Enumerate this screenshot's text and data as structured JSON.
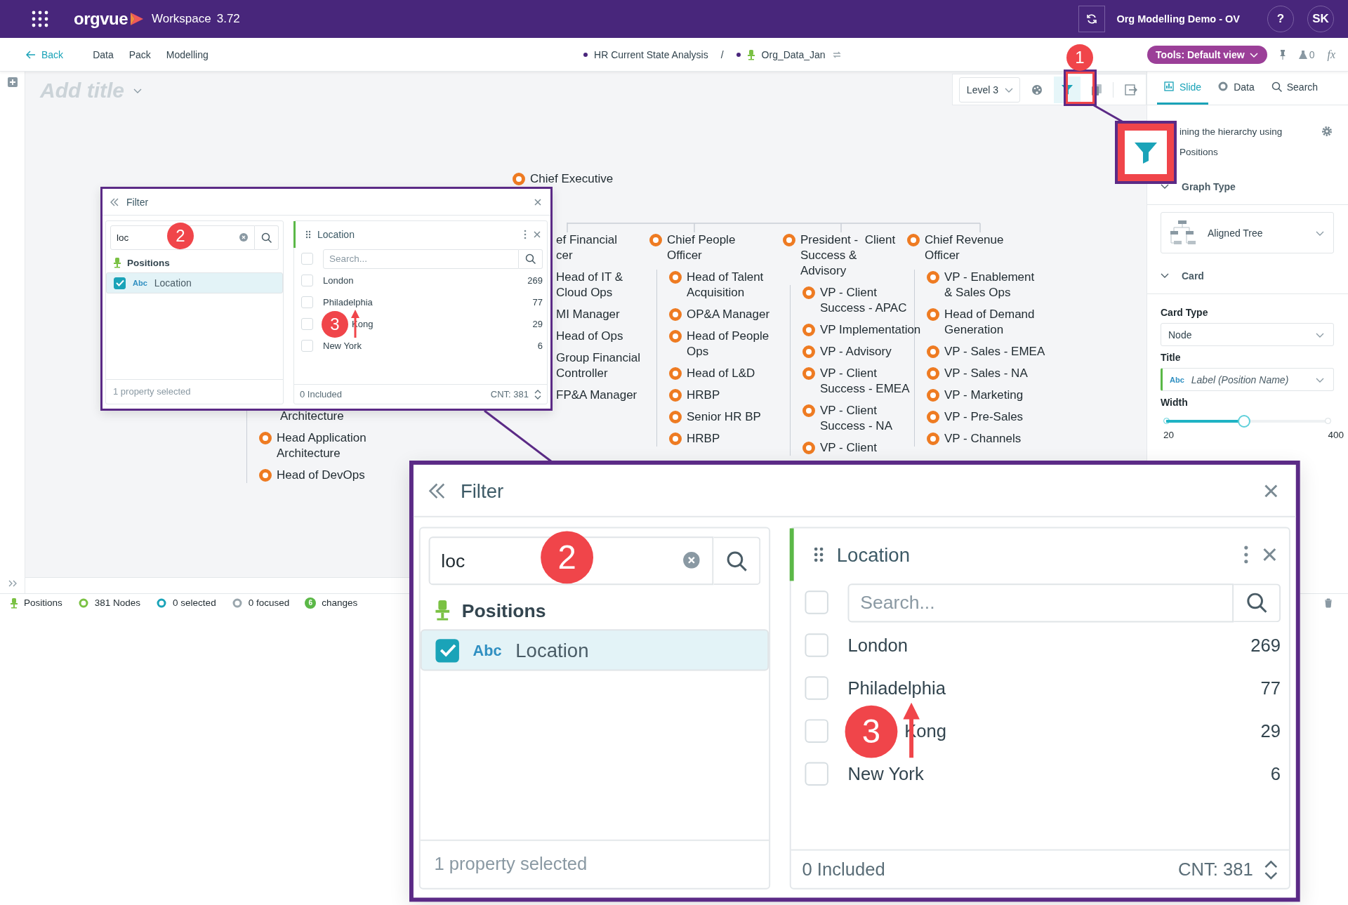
{
  "top_bar": {
    "logo": "orgvue",
    "product": "Workspace",
    "version": "3.72",
    "project": "Org Modelling Demo - OV",
    "help": "?",
    "user": "SK"
  },
  "nav": {
    "back": "Back",
    "links": [
      "Data",
      "Pack",
      "Modelling"
    ],
    "breadcrumb": [
      {
        "kind": "pack",
        "label": "HR Current State Analysis"
      },
      {
        "kind": "dataset",
        "label": "Org_Data_Jan"
      }
    ],
    "separator": "/",
    "tools": "Tools: Default view",
    "flask_count": "0",
    "formula": "fx"
  },
  "canvas": {
    "title_placeholder": "Add title",
    "level": "Level 3",
    "filter_active": true
  },
  "org_chart": {
    "root": {
      "label": "Chief Executive",
      "marker": true
    },
    "columns": [
      {
        "kind": "clipped",
        "label": "ef Financial\ncer",
        "marker": false,
        "children": [
          {
            "label": "Head of IT &\nCloud Ops",
            "marker": false
          },
          {
            "label": "MI Manager",
            "marker": false
          },
          {
            "label": "Head of Ops",
            "marker": false
          },
          {
            "label": "Group Financial\nController",
            "marker": false
          },
          {
            "label": "FP&A Manager",
            "marker": false
          }
        ]
      },
      {
        "kind": "full",
        "label": "Chief People\nOfficer",
        "marker": true,
        "children": [
          {
            "label": "Head of Talent\nAcquisition",
            "marker": true
          },
          {
            "label": "OP&A Manager",
            "marker": true
          },
          {
            "label": "Head of People\nOps",
            "marker": true
          },
          {
            "label": "Head of L&D",
            "marker": true
          },
          {
            "label": "HRBP",
            "marker": true
          },
          {
            "label": "Senior HR BP",
            "marker": true
          },
          {
            "label": "HRBP",
            "marker": true
          }
        ]
      },
      {
        "kind": "full",
        "label": "President -  Client\nSuccess &\nAdvisory",
        "marker": true,
        "children": [
          {
            "label": "VP - Client\nSuccess - APAC",
            "marker": true
          },
          {
            "label": "VP Implementation",
            "marker": true
          },
          {
            "label": "VP - Advisory",
            "marker": true
          },
          {
            "label": "VP - Client\nSuccess - EMEA",
            "marker": true
          },
          {
            "label": "VP - Client\nSuccess - NA",
            "marker": true
          },
          {
            "label": "VP - Client",
            "marker": true
          }
        ]
      },
      {
        "kind": "full",
        "label": "Chief Revenue\nOfficer",
        "marker": true,
        "children": [
          {
            "label": "VP - Enablement\n& Sales Ops",
            "marker": true
          },
          {
            "label": "Head of Demand\nGeneration",
            "marker": true
          },
          {
            "label": "VP - Sales - EMEA",
            "marker": true
          },
          {
            "label": "VP - Sales - NA",
            "marker": true
          },
          {
            "label": "VP - Marketing",
            "marker": true
          },
          {
            "label": "VP - Pre-Sales",
            "marker": true
          },
          {
            "label": "VP - Channels",
            "marker": true
          }
        ]
      }
    ],
    "left_branch": [
      {
        "label": "Architecture",
        "marker": false
      },
      {
        "label": "Head Application\nArchitecture",
        "marker": true
      },
      {
        "label": "Head of DevOps",
        "marker": true
      }
    ]
  },
  "filter_panel": {
    "title": "Filter",
    "search": {
      "value": "loc"
    },
    "property_group": "Positions",
    "properties": [
      {
        "type": "Abc",
        "label": "Location",
        "checked": true,
        "selected": true
      }
    ],
    "footer": "1 property selected",
    "facet": {
      "title": "Location",
      "all_checked": false,
      "search": {
        "placeholder": "Search..."
      },
      "values": [
        {
          "kind": "full",
          "label": "London",
          "count": "269",
          "checked": false
        },
        {
          "kind": "full",
          "label": "Philadelphia",
          "count": "77",
          "checked": false
        },
        {
          "kind": "partial",
          "label": "Kong",
          "count": "29",
          "checked": false
        },
        {
          "kind": "full",
          "label": "New York",
          "count": "6",
          "checked": false
        }
      ],
      "included": "0 Included",
      "count": "CNT: 381"
    },
    "badges": [
      {
        "number": "2"
      },
      {
        "number": "3"
      }
    ]
  },
  "filter_panel_zoomed": {
    "title": "Filter",
    "search": {
      "value": "loc"
    },
    "property_group": "Positions",
    "properties": [
      {
        "type": "Abc",
        "label": "Location",
        "checked": true,
        "selected": true
      }
    ],
    "footer": "1 property selected",
    "facet": {
      "title": "Location",
      "all_checked": false,
      "search": {
        "placeholder": "Search..."
      },
      "values": [
        {
          "kind": "full",
          "label": "London",
          "count": "269",
          "checked": false
        },
        {
          "kind": "full",
          "label": "Philadelphia",
          "count": "77",
          "checked": false
        },
        {
          "kind": "partial",
          "label": "Kong",
          "count": "29",
          "checked": false
        },
        {
          "kind": "full",
          "label": "New York",
          "count": "6",
          "checked": false
        }
      ],
      "included": "0 Included",
      "count": "CNT: 381"
    },
    "badges": [
      {
        "number": "2"
      },
      {
        "number": "3"
      }
    ]
  },
  "panel_tabs": [
    {
      "kind": "slide",
      "label": "Slide",
      "selected": true
    },
    {
      "kind": "data",
      "label": "Data",
      "selected": false
    },
    {
      "kind": "search",
      "label": "Search",
      "selected": false
    }
  ],
  "settings": {
    "note": "ining the hierarchy using",
    "note_source": "Positions",
    "graph_type": {
      "label": "Graph Type",
      "expanded": true,
      "value": "Aligned Tree"
    },
    "card": {
      "label": "Card",
      "expanded": true,
      "card_type_label": "Card Type",
      "card_type": "Node",
      "title_label": "Title",
      "title_type": "Abc",
      "title_value": "Label (Position Name)",
      "width_label": "Width",
      "width": {
        "level": 0.48,
        "min": "20",
        "max": "400"
      }
    }
  },
  "status_bar": [
    {
      "kind": "positions",
      "label": "Positions"
    },
    {
      "kind": "nodes",
      "label": "381 Nodes"
    },
    {
      "kind": "selected",
      "label": "0 selected"
    },
    {
      "kind": "focused",
      "label": "0 focused"
    },
    {
      "kind": "changes",
      "count": "6",
      "label": "changes"
    }
  ],
  "callouts": [
    {
      "number": "1"
    }
  ]
}
